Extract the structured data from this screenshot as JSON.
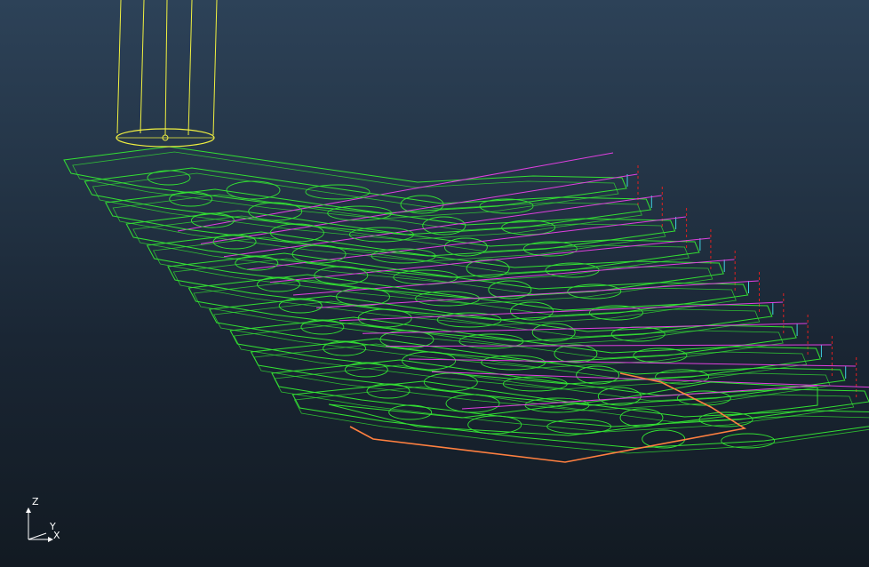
{
  "viewport": {
    "background_top": "#2d4258",
    "background_bottom": "#121a22"
  },
  "toolpath": {
    "pass_color": "#33e033",
    "link_color": "#e040e0",
    "rapid_color": "#e02020",
    "plunge_color": "#40d0e0",
    "boundary_color": "#ff8040",
    "tool_color": "#f0f040",
    "z_levels": 12
  },
  "triad": {
    "z_label": "Z",
    "y_label": "Y",
    "x_label": "X",
    "color": "#ffffff"
  }
}
